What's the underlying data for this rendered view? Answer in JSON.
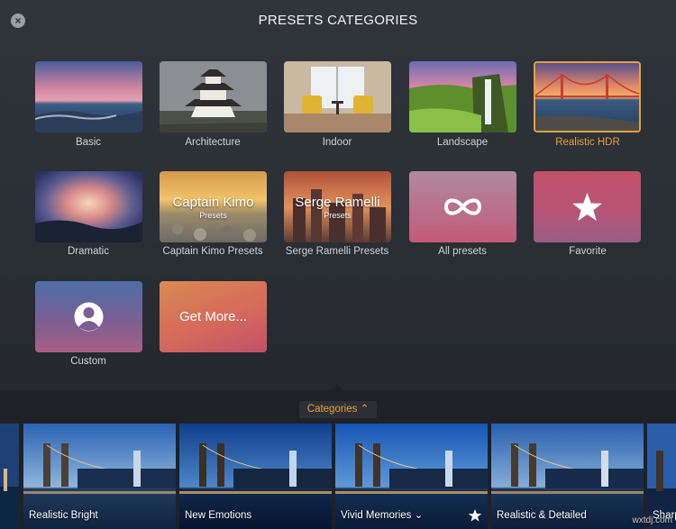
{
  "header": {
    "title": "PRESETS CATEGORIES",
    "close_glyph": "×"
  },
  "categories": [
    {
      "label": "Basic"
    },
    {
      "label": "Architecture"
    },
    {
      "label": "Indoor"
    },
    {
      "label": "Landscape"
    },
    {
      "label": "Realistic HDR",
      "selected": true
    },
    {
      "label": "Dramatic"
    },
    {
      "label": "Captain Kimo Presets",
      "title": "Captain Kimo",
      "subtitle": "Presets"
    },
    {
      "label": "Serge Ramelli Presets",
      "title": "Serge Ramelli",
      "subtitle": "Presets"
    },
    {
      "label": "All presets",
      "icon": "infinity-icon"
    },
    {
      "label": "Favorite",
      "icon": "star-icon"
    },
    {
      "label": "Custom",
      "icon": "user-icon"
    },
    {
      "label": "Get More...",
      "title": "Get More..."
    }
  ],
  "toggle": {
    "label": "Categories",
    "icon": "chevron-up-icon"
  },
  "presets": [
    {
      "label": "Realistic Bright"
    },
    {
      "label": "New Emotions"
    },
    {
      "label": "Vivid Memories",
      "icon": "chevron-down-icon",
      "badge": "star-icon"
    },
    {
      "label": "Realistic & Detailed"
    },
    {
      "label": "Sharp"
    }
  ],
  "watermark": "wxtdj.com",
  "colors": {
    "accent": "#e8a23a",
    "background": "#2b2f36",
    "strip": "#1e2125"
  }
}
